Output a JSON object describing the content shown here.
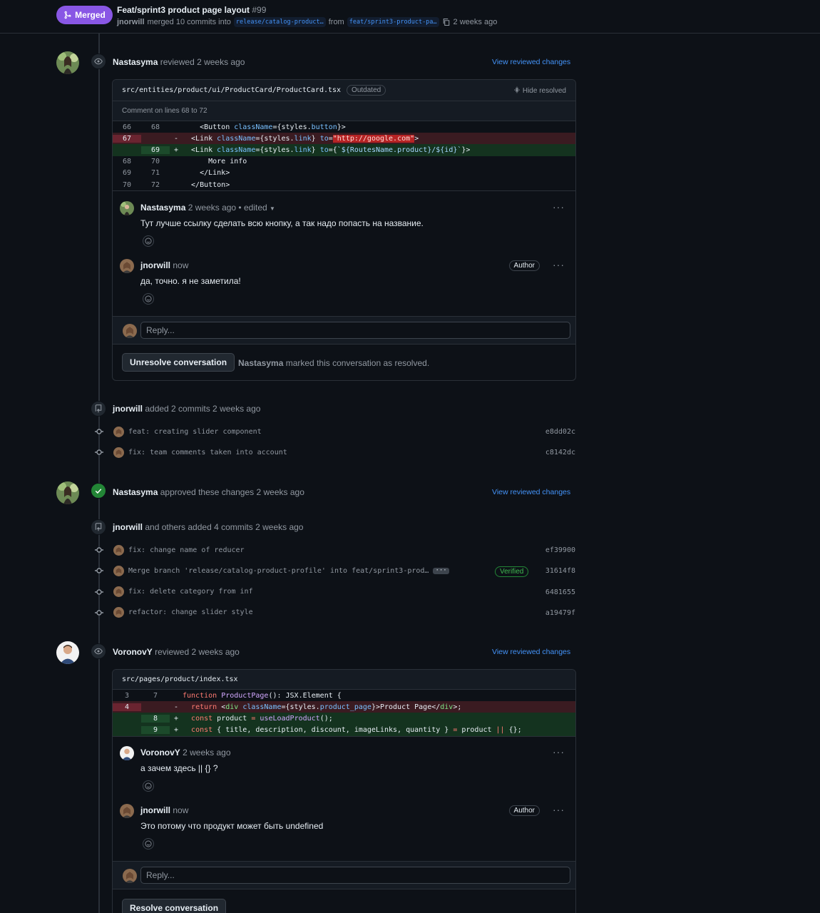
{
  "header": {
    "status": "Merged",
    "title": "Feat/sprint3 product page layout",
    "number": "#99",
    "author": "jnorwill",
    "merged_text": "merged 10 commits into",
    "base_branch": "release/catalog-product…",
    "from_text": "from",
    "head_branch": "feat/sprint3-product-pa…",
    "time": "2 weeks ago"
  },
  "review1": {
    "user": "Nastasyma",
    "action": "reviewed 2 weeks ago",
    "view_link": "View reviewed changes",
    "file": "src/entities/product/ui/ProductCard/ProductCard.tsx",
    "outdated": "Outdated",
    "hide_resolved": "Hide resolved",
    "comment_on": "Comment on lines 68 to 72",
    "lines": [
      {
        "a": "66",
        "b": "68",
        "sign": "",
        "type": "ctx"
      },
      {
        "a": "67",
        "b": "",
        "sign": "-",
        "type": "del"
      },
      {
        "a": "",
        "b": "69",
        "sign": "+",
        "type": "add"
      },
      {
        "a": "68",
        "b": "70",
        "sign": "",
        "type": "ctx"
      },
      {
        "a": "69",
        "b": "71",
        "sign": "",
        "type": "ctx"
      },
      {
        "a": "70",
        "b": "72",
        "sign": "",
        "type": "ctx"
      }
    ],
    "code": {
      "l1": "    <Button className={styles.button}>",
      "l2": "  <Link className={styles.link} to=\"http://google.com\">",
      "l3": "  <Link className={styles.link} to={`${RoutesName.product}/${id}`}>",
      "l4": "      More info",
      "l5": "    </Link>",
      "l6": "  </Button>"
    },
    "comment1": {
      "user": "Nastasyma",
      "meta": "2 weeks ago • edited",
      "body": "Тут лучше ссылку сделать всю кнопку, а так надо попасть на название."
    },
    "comment2": {
      "user": "jnorwill",
      "meta": "now",
      "badge": "Author",
      "body": "да, точно. я не заметила!"
    },
    "reply_placeholder": "Reply...",
    "button": "Unresolve conversation",
    "resolved_user": "Nastasyma",
    "resolved_text": "marked this conversation as resolved."
  },
  "commits1": {
    "user": "jnorwill",
    "action": "added 2 commits 2 weeks ago",
    "items": [
      {
        "msg": "feat: creating slider component",
        "sha": "e8dd02c"
      },
      {
        "msg": "fix: team comments taken into account",
        "sha": "c8142dc"
      }
    ]
  },
  "approval": {
    "user": "Nastasyma",
    "action": "approved these changes 2 weeks ago",
    "view_link": "View reviewed changes"
  },
  "commits2": {
    "user": "jnorwill",
    "action": "and others added 4 commits 2 weeks ago",
    "verified": "Verified",
    "items": [
      {
        "msg": "fix: change name of reducer",
        "sha": "ef39900"
      },
      {
        "msg": "Merge branch 'release/catalog-product-profile' into feat/sprint3-prod…",
        "sha": "31614f8"
      },
      {
        "msg": "fix: delete category from inf",
        "sha": "6481655"
      },
      {
        "msg": "refactor: change slider style",
        "sha": "a19479f"
      }
    ]
  },
  "review2": {
    "user": "VoronovY",
    "action": "reviewed 2 weeks ago",
    "view_link": "View reviewed changes",
    "file": "src/pages/product/index.tsx",
    "lines": [
      {
        "a": "3",
        "b": "7",
        "sign": "",
        "type": "ctx"
      },
      {
        "a": "4",
        "b": "",
        "sign": "-",
        "type": "del"
      },
      {
        "a": "",
        "b": "8",
        "sign": "+",
        "type": "add"
      },
      {
        "a": "",
        "b": "9",
        "sign": "+",
        "type": "add"
      }
    ],
    "code": {
      "l1": "function ProductPage(): JSX.Element {",
      "l2": "  return <div className={styles.product_page}>Product Page</div>;",
      "l3": "  const product = useLoadProduct();",
      "l4": "  const { title, description, discount, imageLinks, quantity } = product || {};"
    },
    "comment1": {
      "user": "VoronovY",
      "meta": "2 weeks ago",
      "body": "а зачем здесь || {} ?"
    },
    "comment2": {
      "user": "jnorwill",
      "meta": "now",
      "badge": "Author",
      "body": "Это потому что продукт может быть undefined"
    },
    "reply_placeholder": "Reply...",
    "button": "Resolve conversation"
  },
  "colors": {
    "merged": "#8957e5",
    "link": "#4493f8",
    "approved": "#238636",
    "bg": "#0d1117"
  }
}
